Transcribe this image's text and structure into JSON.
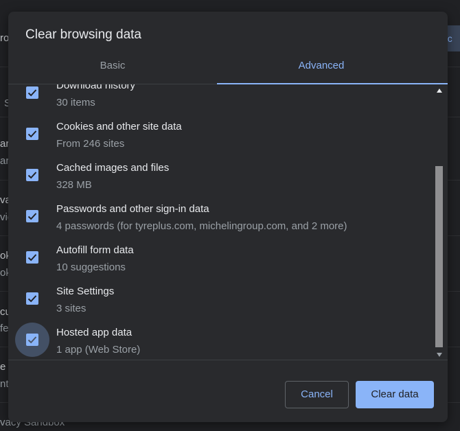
{
  "background": {
    "fragments": [
      "ro",
      "S",
      "ar",
      "ar",
      "va",
      "vie",
      "ok",
      "ok",
      "cu",
      "fe",
      "e S",
      "nt",
      "vacy Sandbox"
    ],
    "chip_label": "ec"
  },
  "dialog": {
    "title": "Clear browsing data",
    "tabs": {
      "basic": "Basic",
      "advanced": "Advanced"
    },
    "items": [
      {
        "title": "Download history",
        "subtitle": "30 items"
      },
      {
        "title": "Cookies and other site data",
        "subtitle": "From 246 sites"
      },
      {
        "title": "Cached images and files",
        "subtitle": "328 MB"
      },
      {
        "title": "Passwords and other sign-in data",
        "subtitle": "4 passwords (for tyreplus.com, michelingroup.com, and 2 more)"
      },
      {
        "title": "Autofill form data",
        "subtitle": "10 suggestions"
      },
      {
        "title": "Site Settings",
        "subtitle": "3 sites"
      },
      {
        "title": "Hosted app data",
        "subtitle": "1 app (Web Store)"
      }
    ],
    "buttons": {
      "cancel": "Cancel",
      "clear": "Clear data"
    }
  },
  "colors": {
    "accent": "#8ab4f8",
    "dialog_bg": "#292a2d",
    "page_bg": "#202124"
  }
}
